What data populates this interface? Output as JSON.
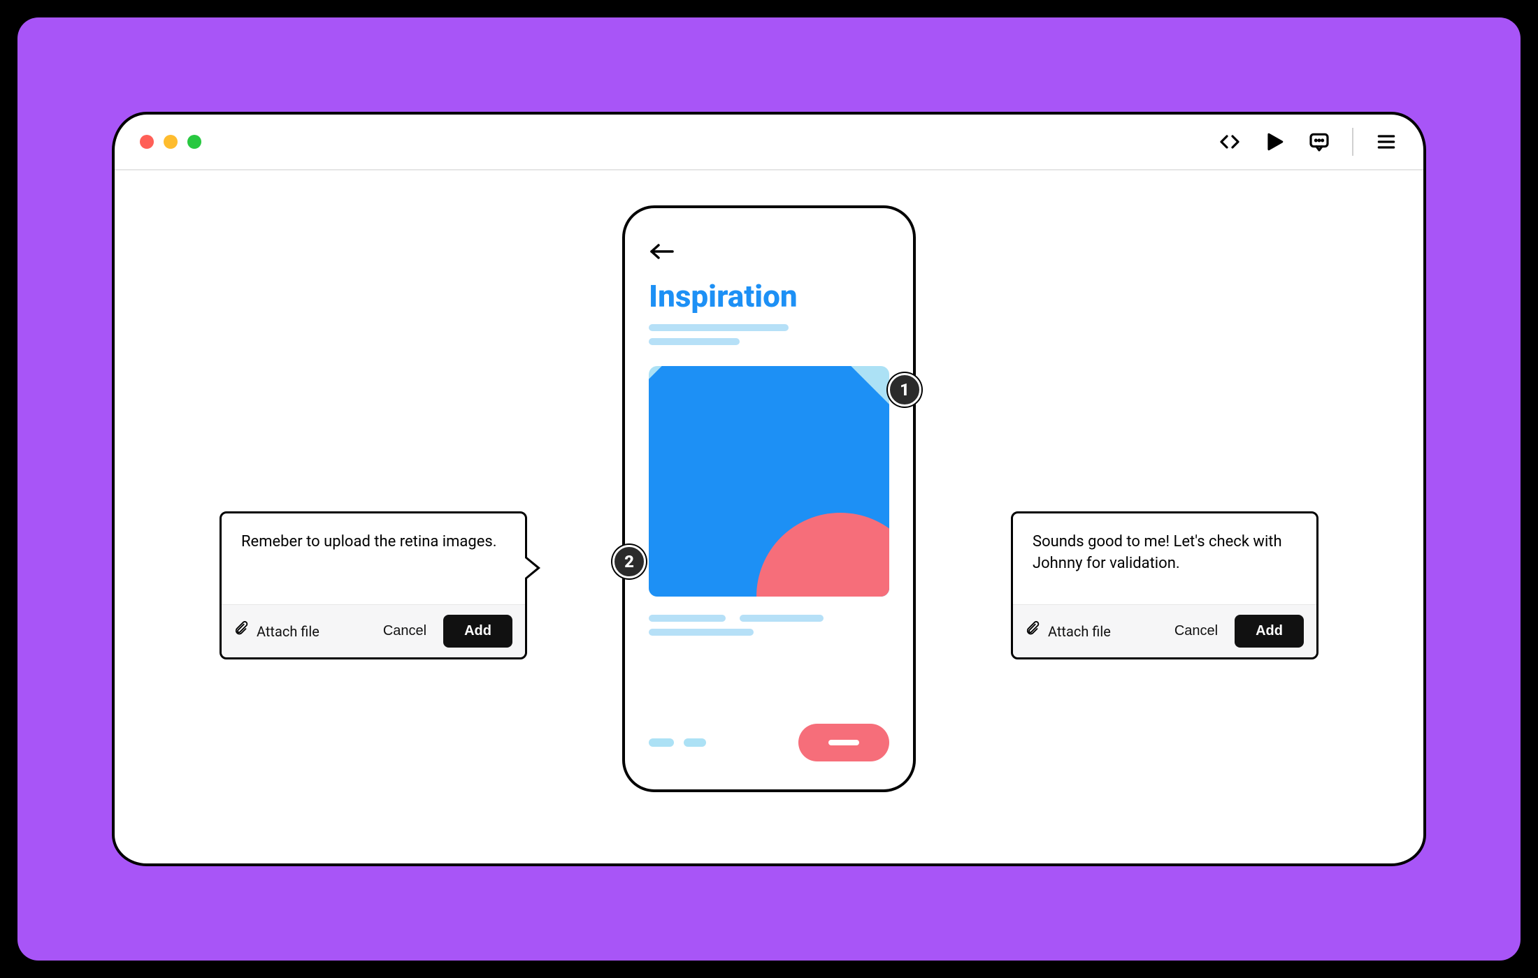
{
  "toolbar": {
    "icons": [
      "code",
      "play",
      "comment",
      "menu"
    ]
  },
  "phone": {
    "title": "Inspiration"
  },
  "hotspots": {
    "one": "1",
    "two": "2"
  },
  "comments": {
    "left": {
      "text": "Remeber to upload the retina images.",
      "attach_label": "Attach file",
      "cancel_label": "Cancel",
      "add_label": "Add"
    },
    "right": {
      "text": "Sounds good to me! Let's check with Johnny for validation.",
      "attach_label": "Attach file",
      "cancel_label": "Cancel",
      "add_label": "Add"
    }
  }
}
